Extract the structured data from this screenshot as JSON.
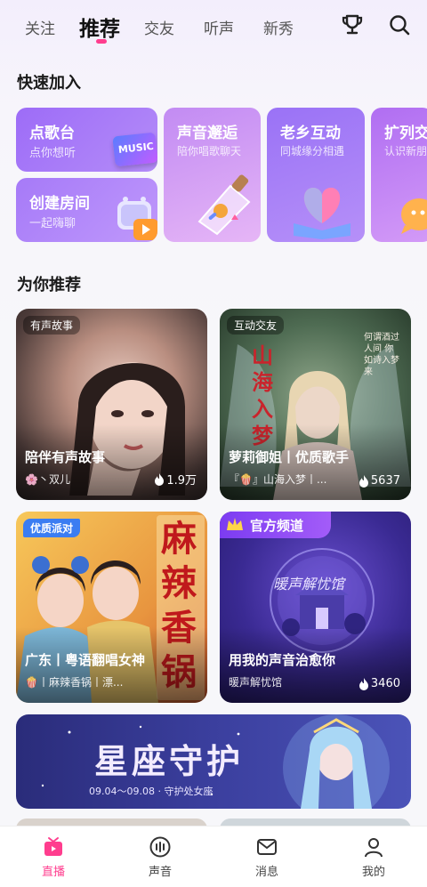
{
  "tabs": [
    "关注",
    "推荐",
    "交友",
    "听声",
    "新秀"
  ],
  "active_tab": "推荐",
  "quick_join": {
    "title": "快速加入",
    "cards": [
      {
        "title": "点歌台",
        "subtitle": "点你想听",
        "art_text": "MUSIC"
      },
      {
        "title": "创建房间",
        "subtitle": "一起嗨聊"
      },
      {
        "title": "声音邂逅",
        "subtitle": "陪你唱歌聊天"
      },
      {
        "title": "老乡互动",
        "subtitle": "同城缘分相遇"
      },
      {
        "title": "扩列交",
        "subtitle": "认识新朋"
      }
    ]
  },
  "recommend": {
    "title": "为你推荐",
    "cards": [
      {
        "tag": "有声故事",
        "title": "陪伴有声故事",
        "sub": "🌸丶双儿",
        "count": "1.9万"
      },
      {
        "tag": "互动交友",
        "title": "萝莉御姐丨优质歌手",
        "sub": "『🍿』山海入梦丨...",
        "count": "5637",
        "art_text": "山海入梦",
        "art_poem": "何谓酒过人间 你如诗入梦来"
      },
      {
        "tag": "优质派对",
        "title": "广东丨粤语翻唱女神",
        "sub": "🍿丨麻辣香锅丨漂...",
        "count": "",
        "art_text": "麻辣香锅"
      },
      {
        "tag": "官方频道",
        "title": "用我的声音治愈你",
        "sub": "暖声解忧馆",
        "count": "3460",
        "art_text": "暖声解忧馆"
      }
    ]
  },
  "banner": {
    "title": "星座守护",
    "date": "09.04～09.08 · 守护处女座"
  },
  "bottom_nav": [
    {
      "label": "直播",
      "icon": "live-icon"
    },
    {
      "label": "声音",
      "icon": "voice-icon"
    },
    {
      "label": "消息",
      "icon": "message-icon"
    },
    {
      "label": "我的",
      "icon": "profile-icon"
    }
  ],
  "colors": {
    "accent": "#ff3d8e",
    "card_purple": "#9b6cf5"
  }
}
